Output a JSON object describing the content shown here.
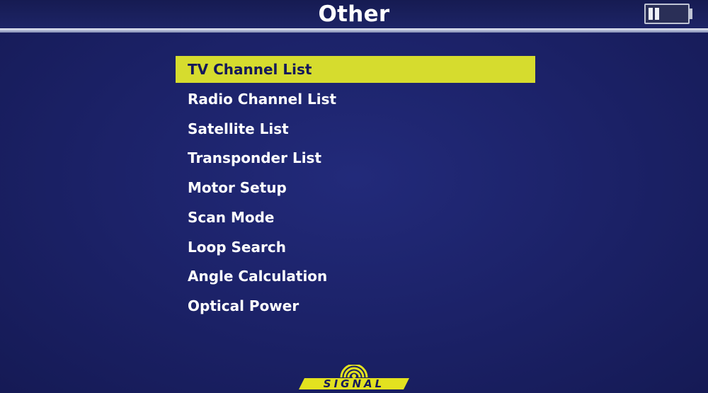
{
  "header": {
    "title": "Other"
  },
  "battery": {
    "level": 0.3
  },
  "menu": {
    "selected_index": 0,
    "items": [
      {
        "label": "TV Channel List"
      },
      {
        "label": "Radio Channel List"
      },
      {
        "label": "Satellite List"
      },
      {
        "label": "Transponder List"
      },
      {
        "label": "Motor Setup"
      },
      {
        "label": "Scan Mode"
      },
      {
        "label": "Loop Search"
      },
      {
        "label": "Angle Calculation"
      },
      {
        "label": "Optical Power"
      }
    ]
  },
  "logo": {
    "text": "SIGNAL"
  },
  "colors": {
    "background": "#1c2267",
    "highlight": "#d6dc2e",
    "text": "#ffffff",
    "logo": "#e3e21f"
  }
}
